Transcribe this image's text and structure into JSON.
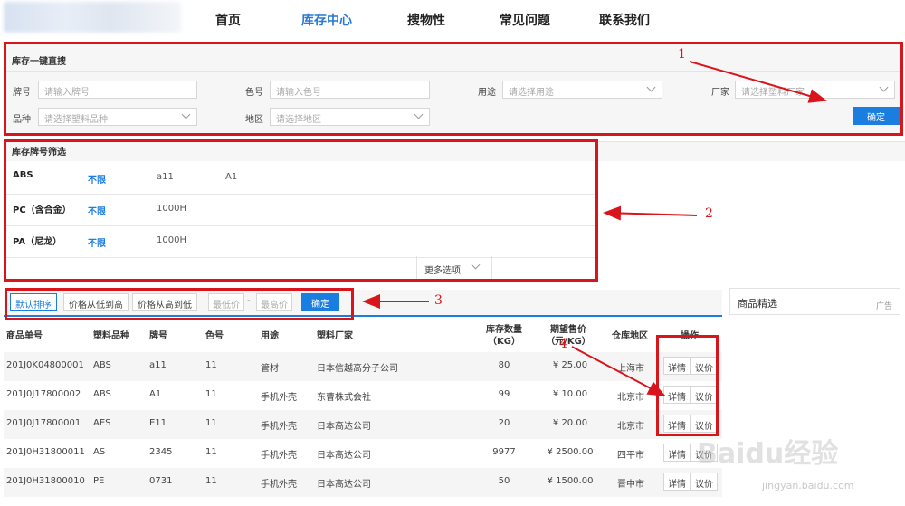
{
  "nav": {
    "items": [
      "首页",
      "库存中心",
      "搜物性",
      "常见问题",
      "联系我们"
    ],
    "active_index": 1
  },
  "search": {
    "title": "库存一键直搜",
    "brand_label": "牌号",
    "brand_placeholder": "请输入牌号",
    "color_label": "色号",
    "color_placeholder": "请输入色号",
    "use_label": "用途",
    "use_placeholder": "请选择用途",
    "maker_label": "厂家",
    "maker_placeholder": "请选择塑料厂家",
    "type_label": "品种",
    "type_placeholder": "请选择塑料品种",
    "region_label": "地区",
    "region_placeholder": "请选择地区",
    "confirm": "确定"
  },
  "filter": {
    "title": "库存牌号筛选",
    "all_label": "不限",
    "rows": [
      {
        "name": "ABS",
        "options": [
          "a11",
          "A1"
        ]
      },
      {
        "name": "PC（含合金）",
        "options": [
          "1000H"
        ]
      },
      {
        "name": "PA（尼龙）",
        "options": [
          "1000H"
        ]
      }
    ],
    "more": "更多选项"
  },
  "sort": {
    "default": "默认排序",
    "price_asc": "价格从低到高",
    "price_desc": "价格从高到低",
    "min_placeholder": "最低价",
    "dash": "-",
    "max_placeholder": "最高价",
    "confirm": "确定"
  },
  "side": {
    "title": "商品精选",
    "tag": "广告"
  },
  "table": {
    "headers": {
      "order_no": "商品单号",
      "type": "塑料品种",
      "brand": "牌号",
      "color": "色号",
      "use": "用途",
      "maker": "塑料厂家",
      "qty_line1": "库存数量",
      "qty_line2": "（KG）",
      "price_line1": "期望售价",
      "price_line2": "（元/KG）",
      "region": "仓库地区",
      "ops": "操作"
    },
    "detail_label": "详情",
    "quote_label": "议价",
    "rows": [
      {
        "order_no": "201J0K04800001",
        "type": "ABS",
        "brand": "a11",
        "color": "11",
        "use": "管材",
        "maker": "日本信越高分子公司",
        "qty": "80",
        "price": "¥ 25.00",
        "region": "上海市"
      },
      {
        "order_no": "201J0J17800002",
        "type": "ABS",
        "brand": "A1",
        "color": "11",
        "use": "手机外壳",
        "maker": "东曹株式会社",
        "qty": "99",
        "price": "¥ 10.00",
        "region": "北京市"
      },
      {
        "order_no": "201J0J17800001",
        "type": "AES",
        "brand": "E11",
        "color": "11",
        "use": "手机外壳",
        "maker": "日本高达公司",
        "qty": "20",
        "price": "¥ 20.00",
        "region": "北京市"
      },
      {
        "order_no": "201J0H31800011",
        "type": "AS",
        "brand": "2345",
        "color": "11",
        "use": "手机外壳",
        "maker": "日本高达公司",
        "qty": "9977",
        "price": "¥ 2500.00",
        "region": "四平市"
      },
      {
        "order_no": "201J0H31800010",
        "type": "PE",
        "brand": "0731",
        "color": "11",
        "use": "手机外壳",
        "maker": "日本高达公司",
        "qty": "50",
        "price": "¥ 1500.00",
        "region": "晋中市"
      }
    ]
  },
  "annotations": {
    "n1": "1",
    "n2": "2",
    "n3": "3",
    "n4": "4",
    "color": "#d9151c"
  },
  "watermark": {
    "text": "Baidu经验",
    "sub": "jingyan.baidu.com"
  }
}
